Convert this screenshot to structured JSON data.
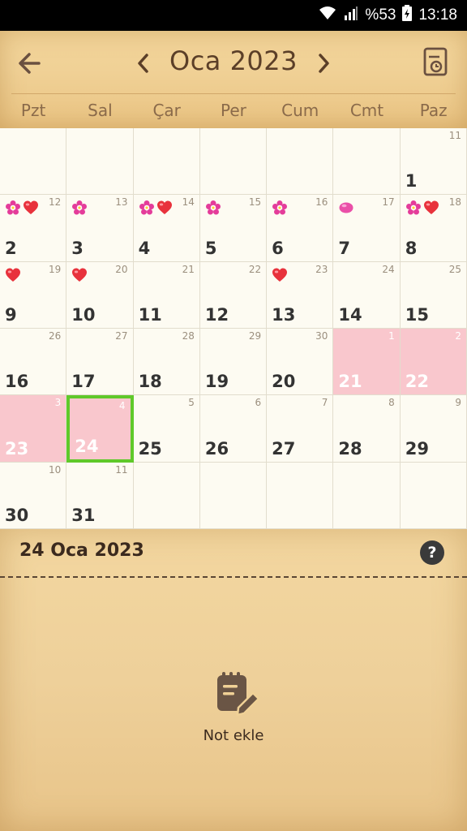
{
  "status_bar": {
    "battery": "%53",
    "time": "13:18"
  },
  "header": {
    "month_title": "Oca 2023",
    "back_icon": "arrow-left-icon",
    "prev_icon": "chevron-left-icon",
    "next_icon": "chevron-right-icon",
    "report_icon": "report-clock-icon"
  },
  "weekdays": [
    "Pzt",
    "Sal",
    "Çar",
    "Per",
    "Cum",
    "Cmt",
    "Paz"
  ],
  "colors": {
    "header_bg": "#f0d196",
    "period_pink": "#f9c7cd",
    "today_border": "#5fc92a",
    "grid_bg": "#fdfbf2"
  },
  "calendar": {
    "rows": [
      [
        {
          "day": "",
          "lunar": ""
        },
        {
          "day": "",
          "lunar": ""
        },
        {
          "day": "",
          "lunar": ""
        },
        {
          "day": "",
          "lunar": ""
        },
        {
          "day": "",
          "lunar": ""
        },
        {
          "day": "",
          "lunar": ""
        },
        {
          "day": "1",
          "lunar": "11"
        }
      ],
      [
        {
          "day": "2",
          "lunar": "12",
          "icons": [
            "flower",
            "heart"
          ]
        },
        {
          "day": "3",
          "lunar": "13",
          "icons": [
            "flower"
          ]
        },
        {
          "day": "4",
          "lunar": "14",
          "icons": [
            "flower",
            "heart"
          ]
        },
        {
          "day": "5",
          "lunar": "15",
          "icons": [
            "flower"
          ]
        },
        {
          "day": "6",
          "lunar": "16",
          "icons": [
            "flower"
          ]
        },
        {
          "day": "7",
          "lunar": "17",
          "icons": [
            "pill"
          ]
        },
        {
          "day": "8",
          "lunar": "18",
          "icons": [
            "flower",
            "heart"
          ]
        }
      ],
      [
        {
          "day": "9",
          "lunar": "19",
          "icons": [
            "heart"
          ]
        },
        {
          "day": "10",
          "lunar": "20",
          "icons": [
            "heart"
          ]
        },
        {
          "day": "11",
          "lunar": "21"
        },
        {
          "day": "12",
          "lunar": "22"
        },
        {
          "day": "13",
          "lunar": "23",
          "icons": [
            "heart"
          ]
        },
        {
          "day": "14",
          "lunar": "24"
        },
        {
          "day": "15",
          "lunar": "25"
        }
      ],
      [
        {
          "day": "16",
          "lunar": "26"
        },
        {
          "day": "17",
          "lunar": "27"
        },
        {
          "day": "18",
          "lunar": "28"
        },
        {
          "day": "19",
          "lunar": "29"
        },
        {
          "day": "20",
          "lunar": "30"
        },
        {
          "day": "21",
          "lunar": "1",
          "period": true
        },
        {
          "day": "22",
          "lunar": "2",
          "period": true
        }
      ],
      [
        {
          "day": "23",
          "lunar": "3",
          "period": true
        },
        {
          "day": "24",
          "lunar": "4",
          "period": true,
          "today": true
        },
        {
          "day": "25",
          "lunar": "5"
        },
        {
          "day": "26",
          "lunar": "6"
        },
        {
          "day": "27",
          "lunar": "7"
        },
        {
          "day": "28",
          "lunar": "8"
        },
        {
          "day": "29",
          "lunar": "9"
        }
      ],
      [
        {
          "day": "30",
          "lunar": "10"
        },
        {
          "day": "31",
          "lunar": "11"
        },
        {
          "day": "",
          "lunar": ""
        },
        {
          "day": "",
          "lunar": ""
        },
        {
          "day": "",
          "lunar": ""
        },
        {
          "day": "",
          "lunar": ""
        },
        {
          "day": "",
          "lunar": ""
        }
      ]
    ]
  },
  "footer": {
    "selected_date": "24 Oca 2023",
    "help_label": "?",
    "add_note_label": "Not ekle",
    "add_note_icon": "notepad-pencil-icon"
  }
}
